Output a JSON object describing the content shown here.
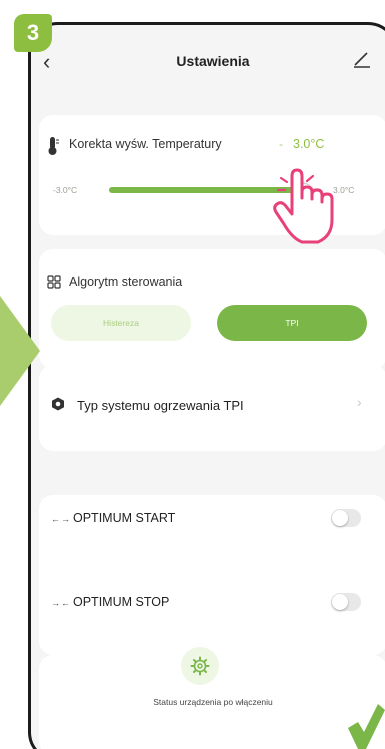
{
  "step": "3",
  "header": {
    "title": "Ustawienia"
  },
  "temperature_correction": {
    "label": "Korekta wyśw. Temperatury",
    "separator": "-",
    "value": "3.0°C",
    "min_label": "-3.0°C",
    "max_label": "3.0°C",
    "slider_fraction": 0.92
  },
  "algorithm": {
    "label": "Algorytm sterowania",
    "options": [
      "Histereza",
      "TPI"
    ],
    "selected": "TPI"
  },
  "tpi_system": {
    "label": "Typ systemu ogrzewania TPI"
  },
  "optimum_start": {
    "label": "OPTIMUM START",
    "enabled": false
  },
  "optimum_stop": {
    "label": "OPTIMUM STOP",
    "enabled": false
  },
  "power_on_status": {
    "label": "Status urządzenia po włączeniu"
  },
  "colors": {
    "accent": "#7ab648",
    "badge": "#8dbe3f",
    "light_green": "#eef6e4"
  },
  "icons": [
    "back-icon",
    "edit-icon",
    "thermometer-icon",
    "grid-icon",
    "hexagon-icon",
    "chevron-right-icon",
    "arrows-icon",
    "gear-icon",
    "hand-pointer-icon"
  ]
}
